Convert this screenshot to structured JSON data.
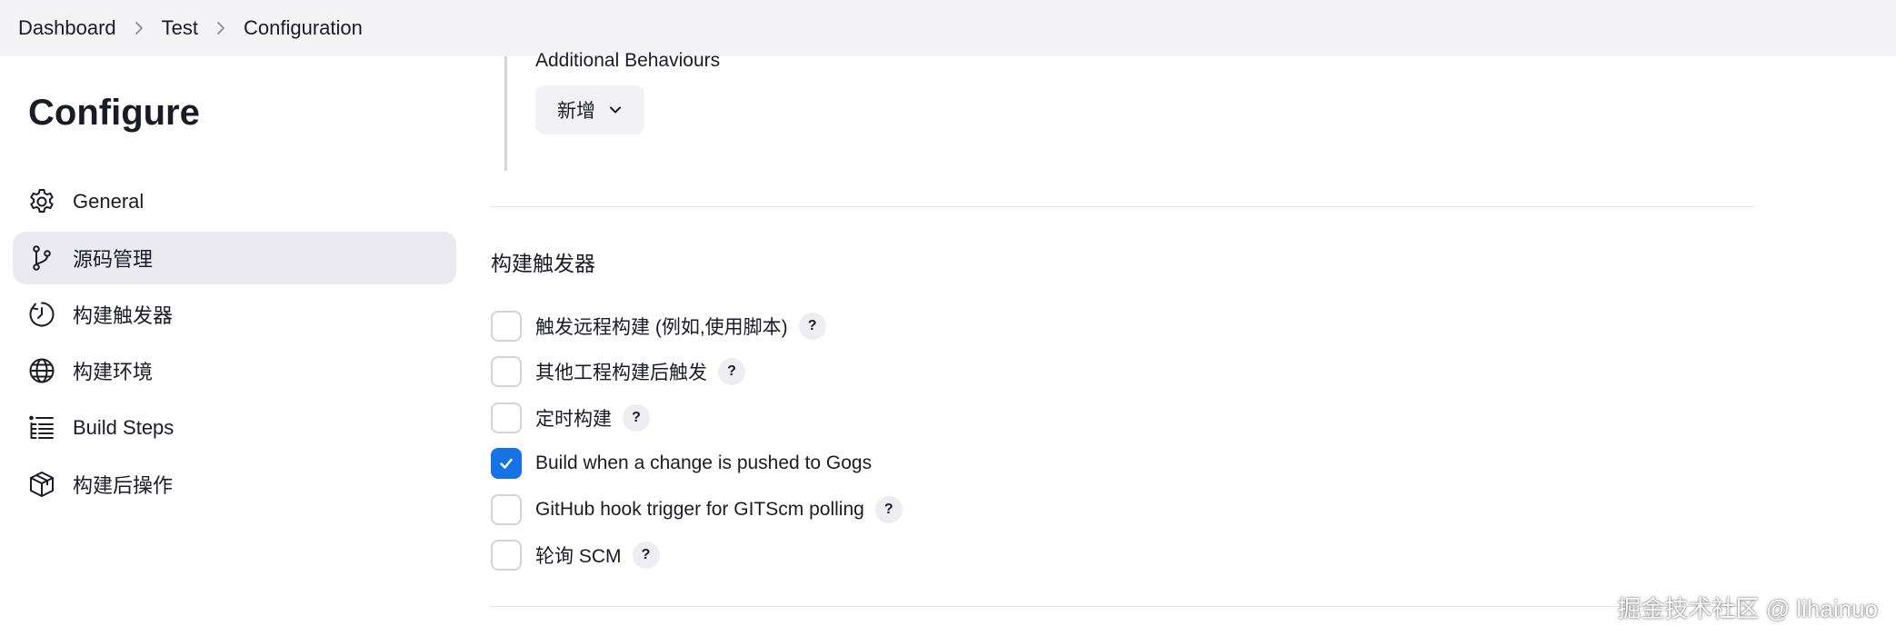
{
  "breadcrumb": {
    "items": [
      "Dashboard",
      "Test",
      "Configuration"
    ]
  },
  "sidebar": {
    "title": "Configure",
    "items": [
      {
        "label": "General",
        "icon": "gear-icon"
      },
      {
        "label": "源码管理",
        "icon": "branch-icon",
        "active": true
      },
      {
        "label": "构建触发器",
        "icon": "clock-icon"
      },
      {
        "label": "构建环境",
        "icon": "globe-icon"
      },
      {
        "label": "Build Steps",
        "icon": "list-icon"
      },
      {
        "label": "构建后操作",
        "icon": "package-icon"
      }
    ]
  },
  "scm": {
    "additional_behaviours_label": "Additional Behaviours",
    "add_button_label": "新增"
  },
  "triggers": {
    "title": "构建触发器",
    "items": [
      {
        "label": "触发远程构建 (例如,使用脚本)",
        "checked": false,
        "help": "?"
      },
      {
        "label": "其他工程构建后触发",
        "checked": false,
        "help": "?"
      },
      {
        "label": "定时构建",
        "checked": false,
        "help": "?"
      },
      {
        "label": "Build when a change is pushed to Gogs",
        "checked": true
      },
      {
        "label": "GitHub hook trigger for GITScm polling",
        "checked": false,
        "help": "?"
      },
      {
        "label": "轮询 SCM",
        "checked": false,
        "help": "?"
      }
    ]
  },
  "colors": {
    "accent": "#1573e6",
    "active_nav_bg": "#eaeaf0",
    "topbar_bg": "#f4f4f7"
  },
  "watermark": "掘金技术社区 @ lihainuo"
}
